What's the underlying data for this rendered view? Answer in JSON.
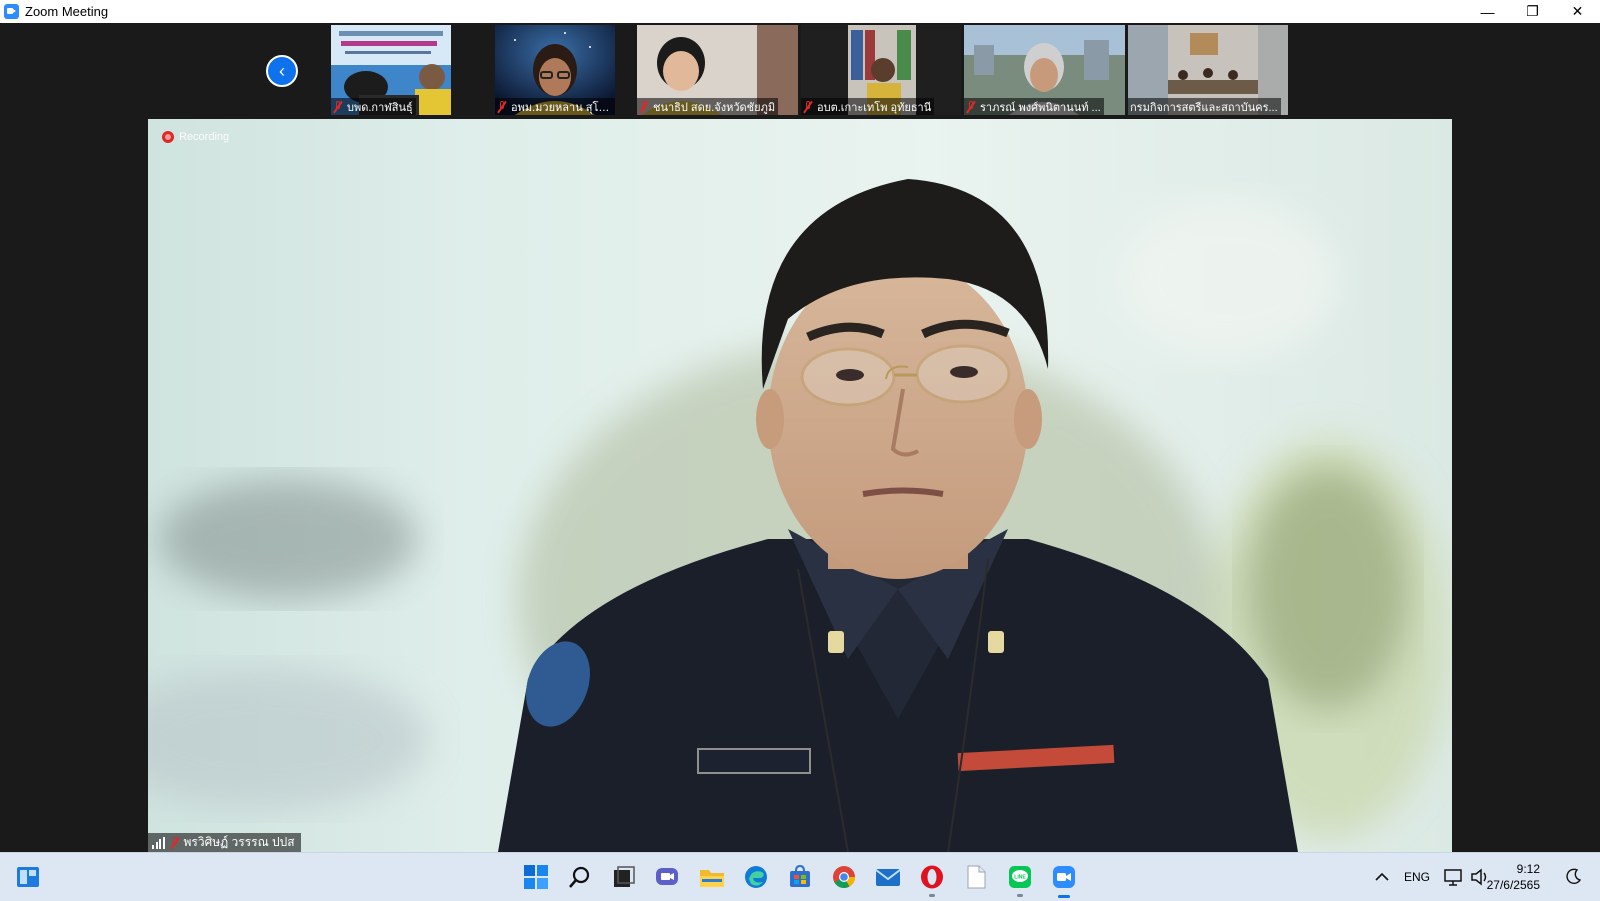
{
  "window": {
    "title": "Zoom Meeting",
    "controls": {
      "minimize": "—",
      "restore": "❐",
      "close": "✕"
    }
  },
  "gallery": {
    "prev_icon": "chevron-left-icon",
    "participants": [
      {
        "name": "บพด.กาฬสินธุ์",
        "muted": true
      },
      {
        "name": "อพม.มวยหลาน สุโขทัย",
        "muted": true
      },
      {
        "name": "ชนาธิป สดย.จังหวัดชัยภูมิ",
        "muted": true
      },
      {
        "name": "อบต.เกาะเทโพ อุทัยธานี",
        "muted": true
      },
      {
        "name": "ราภรณ์ พงศ์พนิตานนท์ ...",
        "muted": true
      },
      {
        "name": "กรมกิจการสตรีและสถาบันคร...",
        "muted": false
      }
    ]
  },
  "main": {
    "recording_label": "Recording",
    "speaker_name": "พรวิศิษฏ์ วรรรณ ปปส",
    "speaker_muted": true
  },
  "taskbar": {
    "widgets_icon": "widgets-icon",
    "apps": [
      "start-icon",
      "search-icon",
      "task-view-icon",
      "teams-chat-icon",
      "file-explorer-icon",
      "edge-icon",
      "store-icon",
      "chrome-icon",
      "mail-icon",
      "opera-icon",
      "notepad-icon",
      "line-icon",
      "zoom-icon"
    ],
    "tray": {
      "language": "ENG",
      "time": "9:12",
      "date": "27/6/2565"
    }
  }
}
